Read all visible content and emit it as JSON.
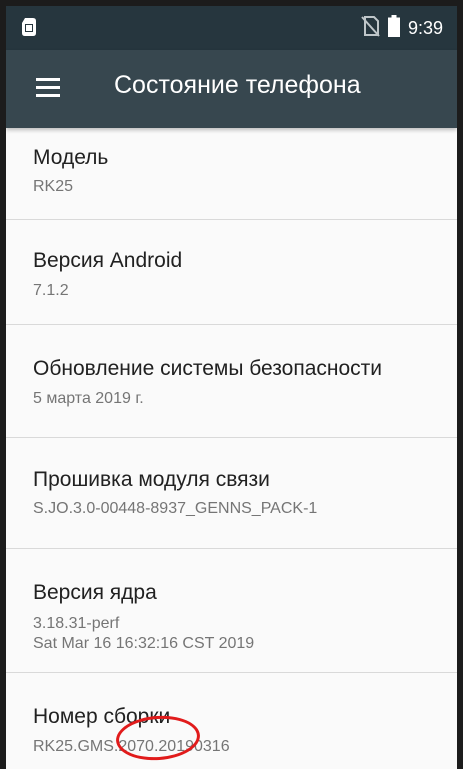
{
  "status_bar": {
    "time": "9:39",
    "left_icon": "sim-card-icon",
    "icons": [
      "no-sim-icon",
      "battery-icon"
    ]
  },
  "toolbar": {
    "menu_icon": "menu-icon",
    "title": "Состояние телефона"
  },
  "items": [
    {
      "label": "Модель",
      "value": "RK25"
    },
    {
      "label": "Версия Android",
      "value": "7.1.2"
    },
    {
      "label": "Обновление системы безопасности",
      "value": "5 марта 2019 г."
    },
    {
      "label": "Прошивка модуля связи",
      "value": "S.JO.3.0-00448-8937_GENNS_PACK-1"
    },
    {
      "label": "Версия ядра",
      "value": "3.18.31-perf",
      "value2": "Sat Mar 16 16:32:16 CST 2019"
    },
    {
      "label": "Номер сборки",
      "value": "RK25.GMS.2070.20190316"
    }
  ],
  "colors": {
    "status_bar": "#26363e",
    "toolbar": "#37474f",
    "annotation": "#e11b1b"
  }
}
